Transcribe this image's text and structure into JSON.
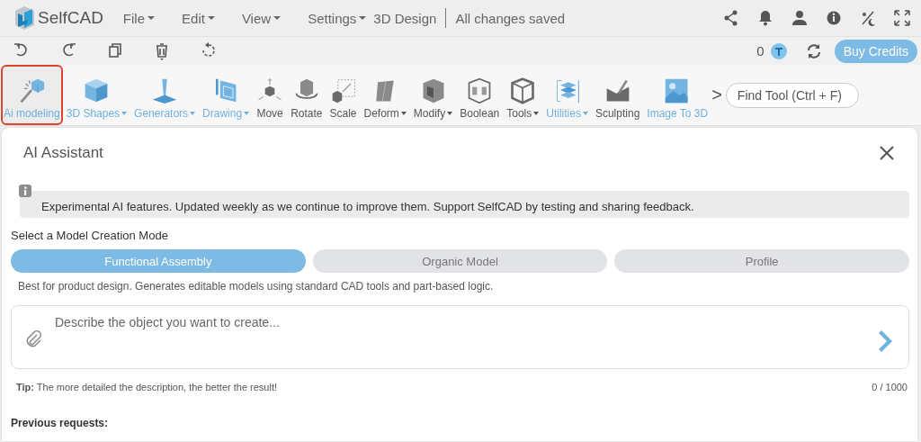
{
  "app": {
    "logo": "SelfCAD",
    "menus": [
      {
        "label": "File"
      },
      {
        "label": "Edit"
      },
      {
        "label": "View"
      },
      {
        "label": "Settings"
      }
    ],
    "project": "3D Design",
    "save_status": "All changes saved"
  },
  "actions": {
    "credits": "0",
    "buy_button": "Buy Credits"
  },
  "tools": [
    {
      "label": "Ai modeling",
      "selected": true,
      "highlighted": true,
      "dropdown": false
    },
    {
      "label": "3D Shapes",
      "selected": false,
      "highlighted": true,
      "dropdown": true
    },
    {
      "label": "Generators",
      "selected": false,
      "highlighted": true,
      "dropdown": true
    },
    {
      "label": "Drawing",
      "selected": false,
      "highlighted": true,
      "dropdown": true
    },
    {
      "label": "Move",
      "selected": false,
      "highlighted": false,
      "dropdown": false
    },
    {
      "label": "Rotate",
      "selected": false,
      "highlighted": false,
      "dropdown": false
    },
    {
      "label": "Scale",
      "selected": false,
      "highlighted": false,
      "dropdown": false
    },
    {
      "label": "Deform",
      "selected": false,
      "highlighted": false,
      "dropdown": true
    },
    {
      "label": "Modify",
      "selected": false,
      "highlighted": false,
      "dropdown": true
    },
    {
      "label": "Boolean",
      "selected": false,
      "highlighted": false,
      "dropdown": false
    },
    {
      "label": "Tools",
      "selected": false,
      "highlighted": false,
      "dropdown": true
    },
    {
      "label": "Utilities",
      "selected": false,
      "highlighted": true,
      "dropdown": true
    },
    {
      "label": "Sculpting",
      "selected": false,
      "highlighted": false,
      "dropdown": false
    },
    {
      "label": "Image To 3D",
      "selected": false,
      "highlighted": true,
      "dropdown": false
    }
  ],
  "more": ">",
  "find_tool": {
    "placeholder": "Find Tool (Ctrl + F)"
  },
  "assistant": {
    "title": "AI Assistant",
    "notice": "Experimental AI features. Updated weekly as we continue to improve them. Support SelfCAD by testing and sharing feedback.",
    "mode_prompt": "Select a Model Creation Mode",
    "modes": [
      {
        "label": "Functional Assembly",
        "selected": true
      },
      {
        "label": "Organic Model",
        "selected": false
      },
      {
        "label": "Profile",
        "selected": false
      }
    ],
    "mode_description": "Best for product design. Generates editable models using standard CAD tools and part-based logic.",
    "prompt": {
      "placeholder": "Describe the object you want to create..."
    },
    "tip": "**Tip:** The more detailed the description, the better the result!",
    "counter": "0 / 1000",
    "history_heading": "Previous requests:"
  }
}
